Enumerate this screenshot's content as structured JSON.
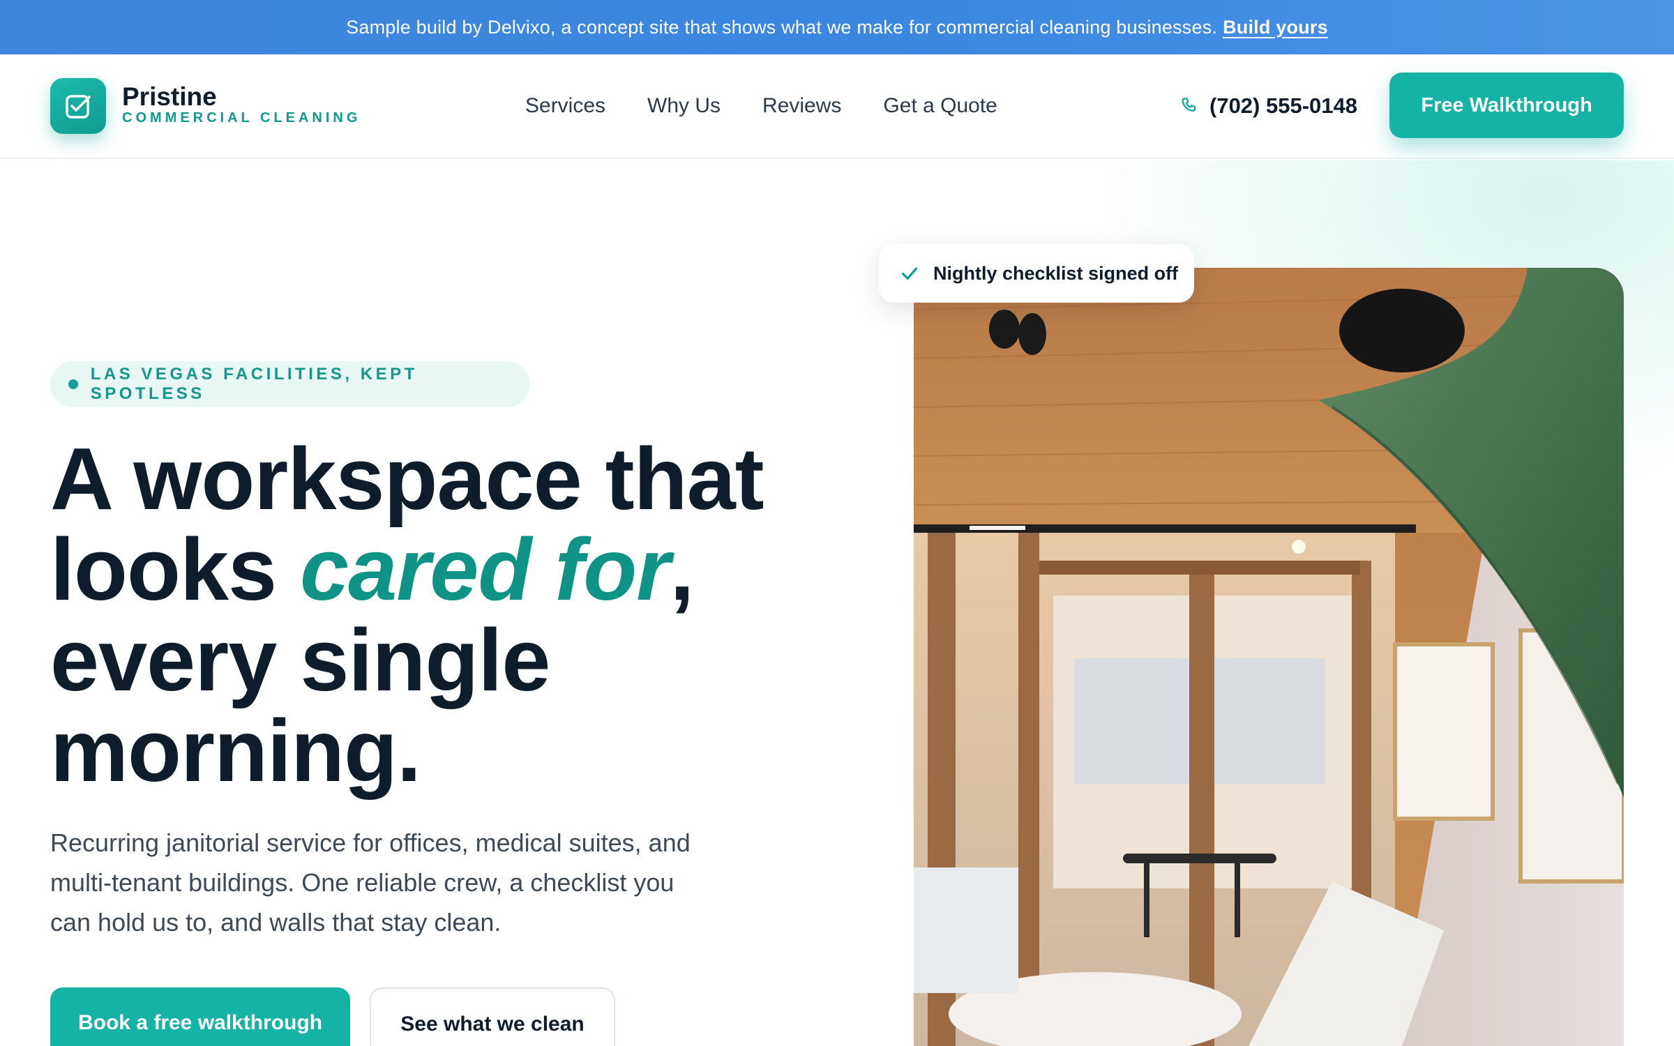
{
  "banner": {
    "text": "Sample build by Delvixo, a concept site that shows what we make for commercial cleaning businesses.",
    "link": "Build yours"
  },
  "brand": {
    "name": "Pristine",
    "tagline": "COMMERCIAL CLEANING",
    "logo_icon": "checkbox-icon",
    "accent": "#14b3a6"
  },
  "nav": {
    "items": [
      {
        "label": "Services"
      },
      {
        "label": "Why Us"
      },
      {
        "label": "Reviews"
      },
      {
        "label": "Get a Quote"
      }
    ],
    "phone": "(702) 555-0148",
    "phone_icon": "phone-icon",
    "cta": "Free Walkthrough"
  },
  "hero": {
    "eyebrow": "LAS VEGAS FACILITIES, KEPT SPOTLESS",
    "headline_part1": "A workspace that looks ",
    "headline_highlight": "cared for",
    "headline_part2": ", every single morning.",
    "subtext": "Recurring janitorial service for offices, medical suites, and multi-tenant buildings. One reliable crew, a checklist you can hold us to, and walls that stay clean.",
    "primary_cta": "Book a free walkthrough",
    "secondary_cta": "See what we clean",
    "badge": "Nightly checklist signed off",
    "badge_icon": "check-icon"
  }
}
